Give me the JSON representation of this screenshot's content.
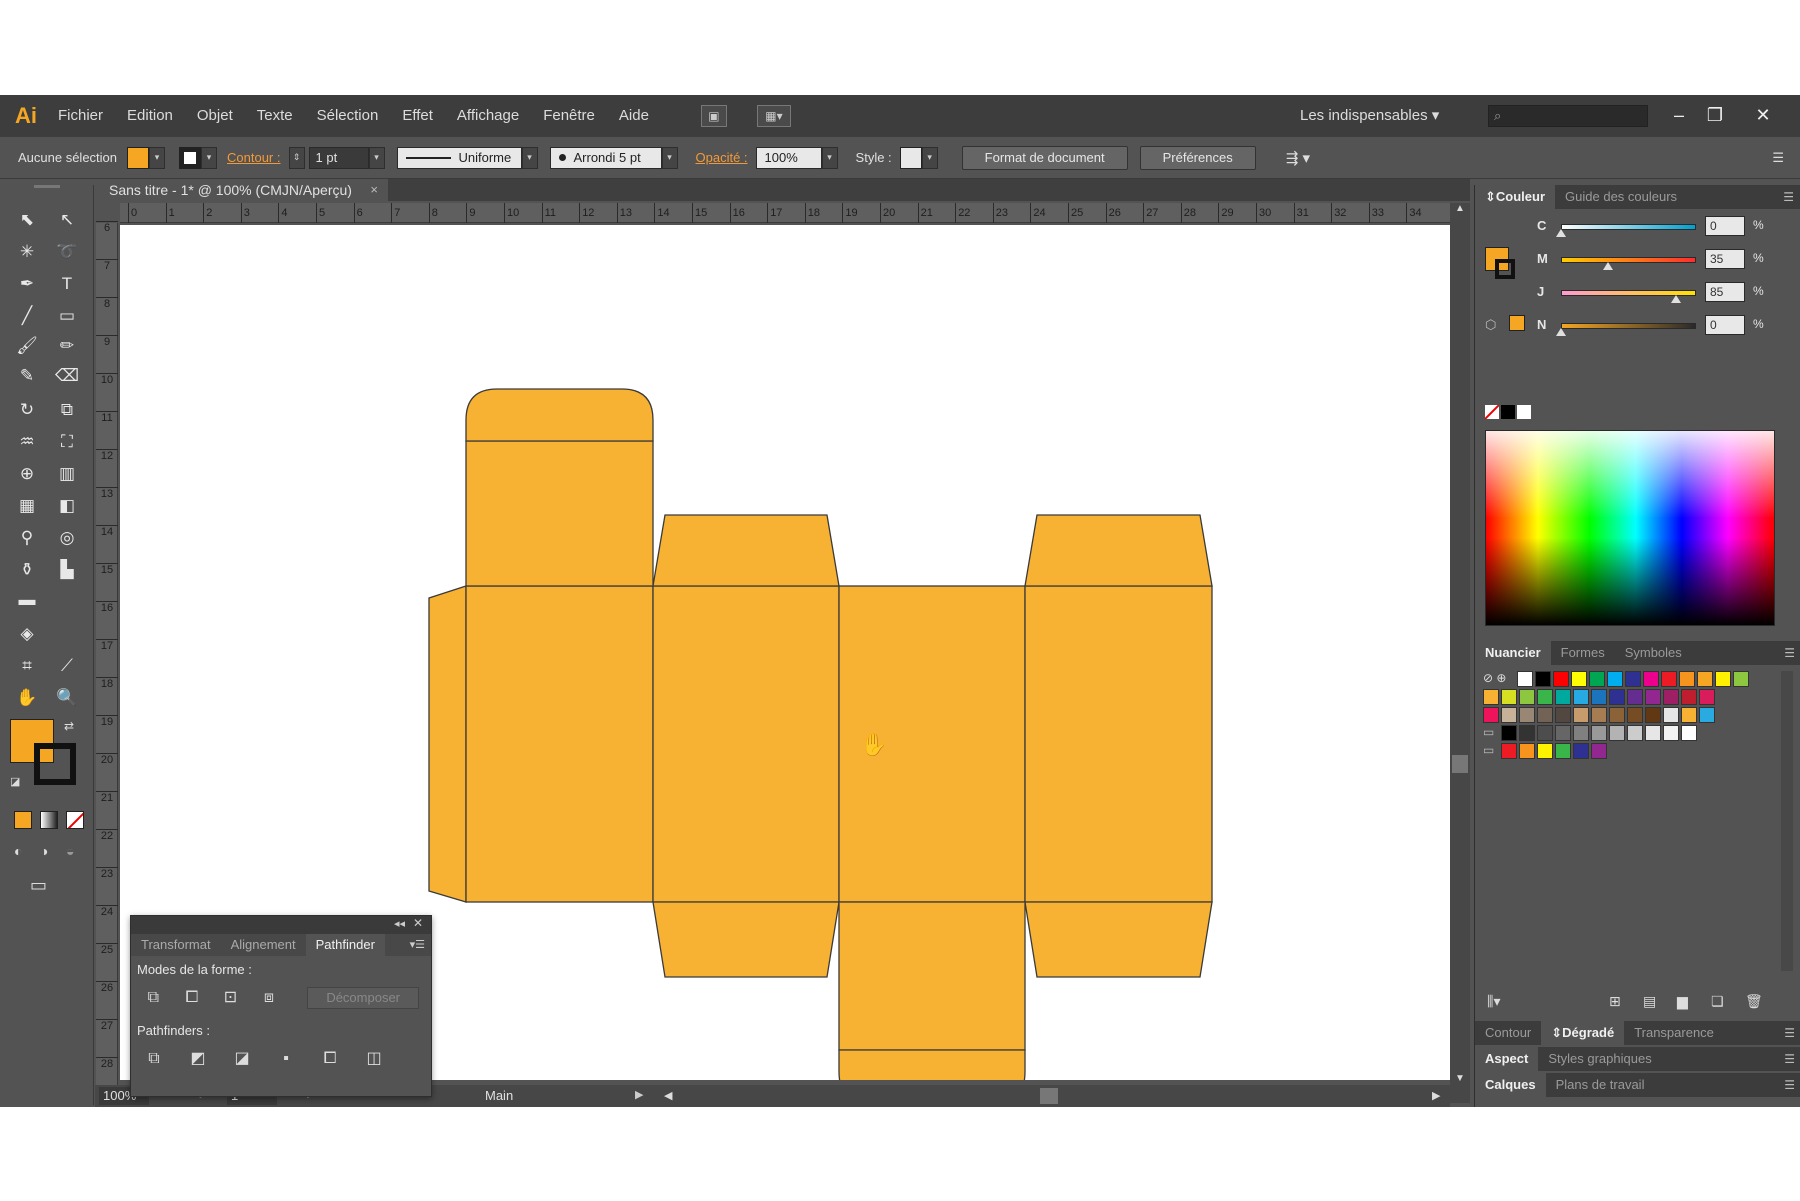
{
  "app": {
    "logo": "Ai",
    "menu": [
      "Fichier",
      "Edition",
      "Objet",
      "Texte",
      "Sélection",
      "Effet",
      "Affichage",
      "Fenêtre",
      "Aide"
    ],
    "workspace": "Les indispensables",
    "window_controls": {
      "minimize": "–",
      "restore": "❐",
      "close": "✕"
    }
  },
  "controlbar": {
    "selection": "Aucune sélection",
    "fill_color": "#f5a623",
    "stroke_label": "Contour :",
    "stroke_weight": "1 pt",
    "stroke_profile": "Uniforme",
    "brush": "Arrondi 5 pt",
    "opacity_label": "Opacité :",
    "opacity": "100%",
    "style_label": "Style :",
    "doc_format": "Format de document",
    "preferences": "Préférences"
  },
  "document": {
    "tab_title": "Sans titre - 1* @ 100% (CMJN/Aperçu)",
    "tab_close": "×",
    "ruler_top": [
      "0",
      "1",
      "2",
      "3",
      "4",
      "5",
      "6",
      "7",
      "8",
      "9",
      "10",
      "11",
      "12",
      "13",
      "14",
      "15",
      "16",
      "17",
      "18",
      "19",
      "20",
      "21",
      "22",
      "23",
      "24",
      "25",
      "26",
      "27",
      "28",
      "29",
      "30",
      "31",
      "32",
      "33",
      "34"
    ],
    "ruler_left": [
      "6",
      "7",
      "8",
      "9",
      "10",
      "11",
      "12",
      "13",
      "14",
      "15",
      "16",
      "17",
      "18",
      "19",
      "20",
      "21",
      "22",
      "23",
      "24",
      "25",
      "26",
      "27",
      "28"
    ],
    "box_color": "#f7b233",
    "stroke_color": "#3a3a3a"
  },
  "status": {
    "zoom": "100%",
    "artboard": "1",
    "tool": "Main"
  },
  "pathfinder": {
    "tabs": [
      "Transformat",
      "Alignement",
      "Pathfinder"
    ],
    "active_tab": "Pathfinder",
    "shape_modes_label": "Modes de la forme :",
    "expand_button": "Décomposer",
    "pathfinders_label": "Pathfinders :"
  },
  "color_panel": {
    "tabs": [
      "Couleur",
      "Guide des couleurs"
    ],
    "channels": [
      {
        "label": "C",
        "value": "0",
        "fraction": 0.0,
        "gradient": "linear-gradient(to right,#ffffff,#00a0d0)"
      },
      {
        "label": "M",
        "value": "35",
        "fraction": 0.35,
        "gradient": "linear-gradient(to right,#ffcc00,#ff2e2e)"
      },
      {
        "label": "J",
        "value": "85",
        "fraction": 0.85,
        "gradient": "linear-gradient(to right,#ff9ad0,#ffe000)"
      },
      {
        "label": "N",
        "value": "0",
        "fraction": 0.0,
        "gradient": "linear-gradient(to right,#f5a623,#2a2a2a)"
      }
    ],
    "percent": "%"
  },
  "swatches_panel": {
    "tabs": [
      "Nuancier",
      "Formes",
      "Symboles"
    ],
    "rows": [
      [
        "#ffffff",
        "#000000",
        "#ff0000",
        "#ffff00",
        "#00a651",
        "#00aeef",
        "#2e3192",
        "#ec008c",
        "#ed1c24",
        "#f7941d",
        "#f5a623",
        "#fff200",
        "#8dc63f"
      ],
      [
        "#f7b233",
        "#d7df23",
        "#8dc63f",
        "#39b54a",
        "#00a99d",
        "#27aae1",
        "#1c75bc",
        "#2e3192",
        "#662d91",
        "#92278f",
        "#9e1f63",
        "#be1e2d",
        "#d91c5c"
      ],
      [
        "#ed145b",
        "#c7b299",
        "#998675",
        "#736357",
        "#534741",
        "#c69c6d",
        "#a67c52",
        "#8c6239",
        "#754c24",
        "#603813",
        "#e6e6e6",
        "#f7b233",
        "#29abe2"
      ],
      [
        "#000000",
        "#333333",
        "#4d4d4d",
        "#666666",
        "#808080",
        "#999999",
        "#b3b3b3",
        "#cccccc",
        "#e6e6e6",
        "#f2f2f2",
        "#ffffff"
      ],
      [
        "#ed1c24",
        "#f7941d",
        "#fff200",
        "#39b54a",
        "#2e3192",
        "#92278f"
      ]
    ]
  },
  "bottom_panels": {
    "row1": [
      "Contour",
      "Dégradé",
      "Transparence"
    ],
    "row1_active": "Dégradé",
    "row2": [
      "Aspect",
      "Styles graphiques"
    ],
    "row3": [
      "Calques",
      "Plans de travail"
    ]
  }
}
